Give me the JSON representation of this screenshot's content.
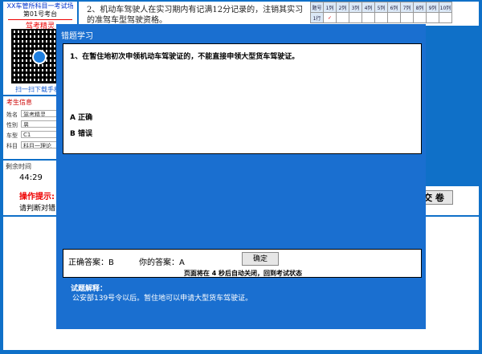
{
  "left": {
    "exam_title": "XX车管所科目一考试场",
    "seat": "第01号考台",
    "brand": "驾考精灵",
    "scan_text": "扫一扫下载手机版"
  },
  "candidate": {
    "title": "考生信息",
    "fields": [
      {
        "label": "姓名",
        "value": "驾考精灵"
      },
      {
        "label": "性别",
        "value": "男"
      },
      {
        "label": "车型",
        "value": "C1"
      },
      {
        "label": "科目",
        "value": "科目一理论"
      }
    ]
  },
  "timer": {
    "label": "剩余时间",
    "value": "44:29"
  },
  "hint": {
    "title": "操作提示:",
    "text": "请判断对错!"
  },
  "submit": {
    "label": "交 卷"
  },
  "background_question": {
    "text": "2、机动车驾驶人在实习期内有记满12分记录的，注销其实习的准驾车型驾驶资格。"
  },
  "grid": {
    "headers": [
      "题号",
      "1列",
      "2列",
      "3列",
      "4列",
      "5列",
      "6列",
      "7列",
      "8列",
      "9列",
      "10列"
    ],
    "first_row_label": "1行",
    "first_row_mark": "✓"
  },
  "modal": {
    "title": "错题学习",
    "question": "1、在暂住地初次申领机动车驾驶证的，不能直接申领大型货车驾驶证。",
    "options": [
      "A 正确",
      "B 错误"
    ],
    "correct_answer_label": "正确答案：B",
    "your_answer_label": "你的答案：A",
    "confirm": "确定",
    "close_note": "页面将在  4  秒后自动关闭，回到考试状态",
    "explain_title": "试题解释：",
    "explain_text": "公安部139号令以后。暂住地可以申请大型货车驾驶证。"
  },
  "colors": {
    "background": "#0f70c8",
    "modal": "#1a6fd0",
    "hint_title": "#e00000"
  }
}
